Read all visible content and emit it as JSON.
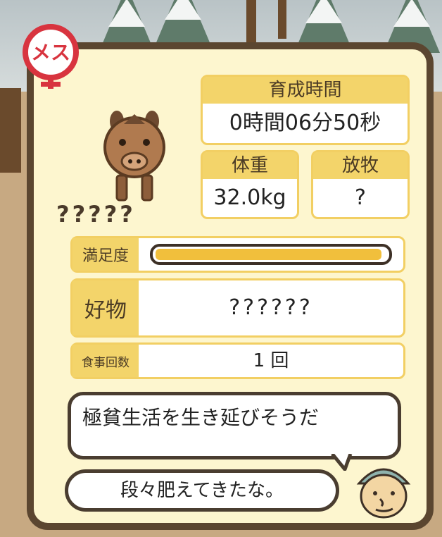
{
  "gender_badge": "メス",
  "breeding_time": {
    "label": "育成時間",
    "value": "0時間06分50秒"
  },
  "weight": {
    "label": "体重",
    "value": "32.0kg"
  },
  "release": {
    "label": "放牧",
    "value": "?"
  },
  "boar_name": "?????",
  "satisfaction": {
    "label": "満足度",
    "level_fraction": 0.98
  },
  "favorite_food": {
    "label": "好物",
    "value": "??????"
  },
  "meal_count": {
    "label": "食事回数",
    "value": "1 回"
  },
  "status_message": "極貧生活を生き延びそうだ",
  "farmer_comment": "段々肥えてきたな。",
  "colors": {
    "panel_border": "#5b4630",
    "panel_bg": "#fdf6cf",
    "header_yellow": "#f3d46a",
    "gauge_fill": "#f1bf3c",
    "badge_red": "#d8343f"
  }
}
